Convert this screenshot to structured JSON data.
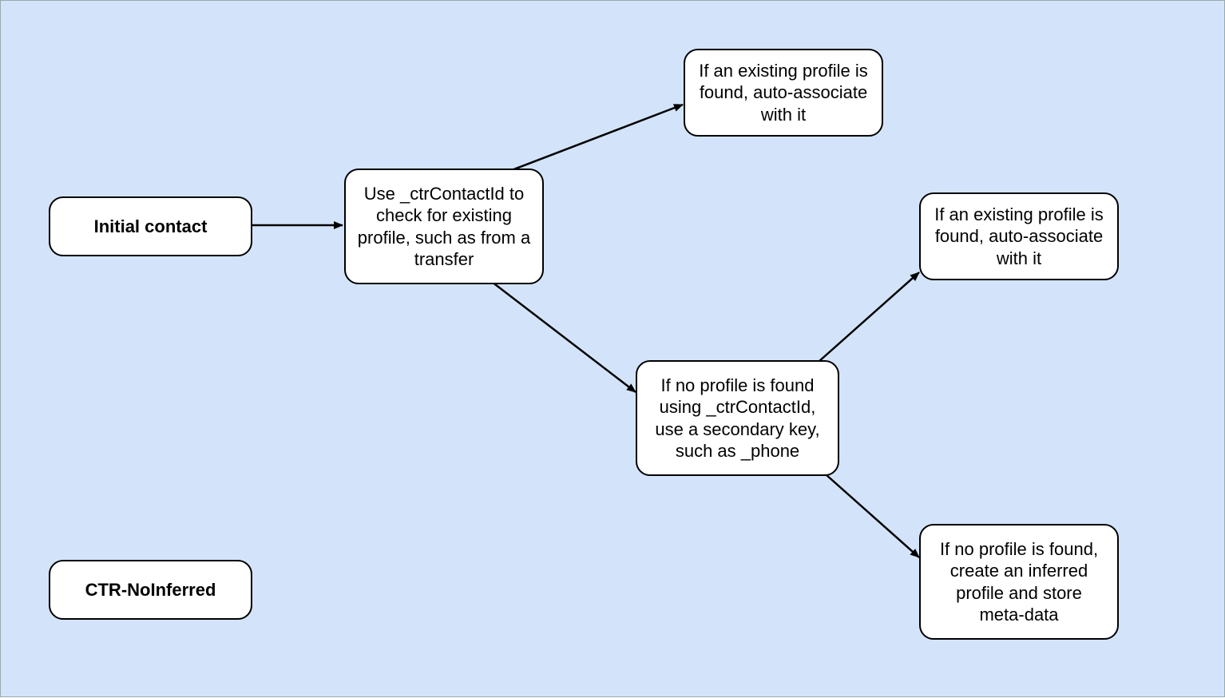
{
  "nodes": {
    "initial_contact": {
      "label": "Initial contact"
    },
    "ctr_noinferred": {
      "label": "CTR-NoInferred"
    },
    "check_ctrcontactid": {
      "label": "Use _ctrContactId to check for existing profile, such as from a transfer"
    },
    "found_auto_associate_top": {
      "label": "If an existing profile is found, auto-associate with it"
    },
    "no_profile_secondary": {
      "label": "If no profile is found using _ctrContactId, use a secondary key, such as _phone"
    },
    "found_auto_associate_right": {
      "label": "If an existing profile is found, auto-associate with it"
    },
    "no_profile_create_inferred": {
      "label": "If no profile is found, create an inferred profile and store meta-data"
    }
  }
}
